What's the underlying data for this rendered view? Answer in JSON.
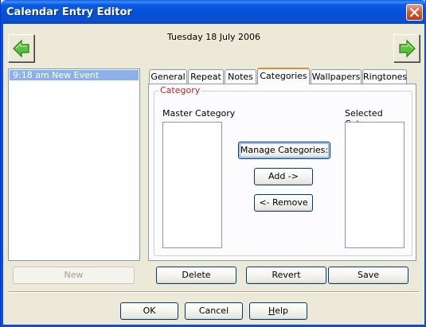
{
  "window": {
    "title": "Calendar Entry Editor"
  },
  "date_label": "Tuesday 18 July 2006",
  "events": [
    {
      "label": "9:18 am New Event"
    }
  ],
  "tabs": [
    {
      "label": "General"
    },
    {
      "label": "Repeat"
    },
    {
      "label": "Notes"
    },
    {
      "label": "Categories"
    },
    {
      "label": "Wallpapers"
    },
    {
      "label": "Ringtones"
    }
  ],
  "active_tab": "Categories",
  "category": {
    "group_label": "Category",
    "master_label": "Master Category",
    "selected_label": "Selected Category",
    "manage_button": "Manage Categories:",
    "add_button": "Add ->",
    "remove_button": "<- Remove"
  },
  "entry_buttons": {
    "new": "New",
    "delete": "Delete",
    "revert": "Revert",
    "save": "Save"
  },
  "dialog_buttons": {
    "ok": "OK",
    "cancel": "Cancel",
    "help_prefix": "H",
    "help_rest": "elp"
  },
  "icons": {
    "close": "close-icon",
    "prev": "arrow-left-icon",
    "next": "arrow-right-icon"
  },
  "colors": {
    "titlebar": "#0b5ae0",
    "group_label": "#d21e1e",
    "selection": "#8cb0ea",
    "active_tab_accent": "#e68b2c",
    "arrow_green": "#3aa626"
  }
}
